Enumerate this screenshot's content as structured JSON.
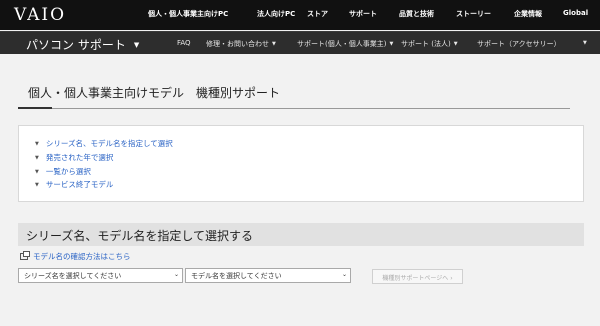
{
  "header": {
    "logo": "VAIO",
    "nav": [
      "個人・個人事業主向けPC",
      "法人向けPC",
      "ストア",
      "サポート",
      "品質と技術",
      "ストーリー",
      "企業情報",
      "Global"
    ]
  },
  "subheader": {
    "title": "パソコン サポート",
    "nav": [
      "FAQ",
      "修理・お問い合わせ",
      "サポート(個人・個人事業主)",
      "サポート (法人)",
      "サポート（アクセサリー）"
    ]
  },
  "page": {
    "title": "個人・個人事業主向けモデル　機種別サポート"
  },
  "panel": {
    "links": [
      "シリーズ名、モデル名を指定して選択",
      "発売された年で選択",
      "一覧から選択",
      "サービス終了モデル"
    ]
  },
  "section": {
    "heading": "シリーズ名、モデル名を指定して選択する",
    "help_link": "モデル名の確認方法はこちら",
    "series_select": "シリーズ名を選択してください",
    "model_select": "モデル名を選択してください",
    "go_button": "機種別サポートページへ ›"
  }
}
